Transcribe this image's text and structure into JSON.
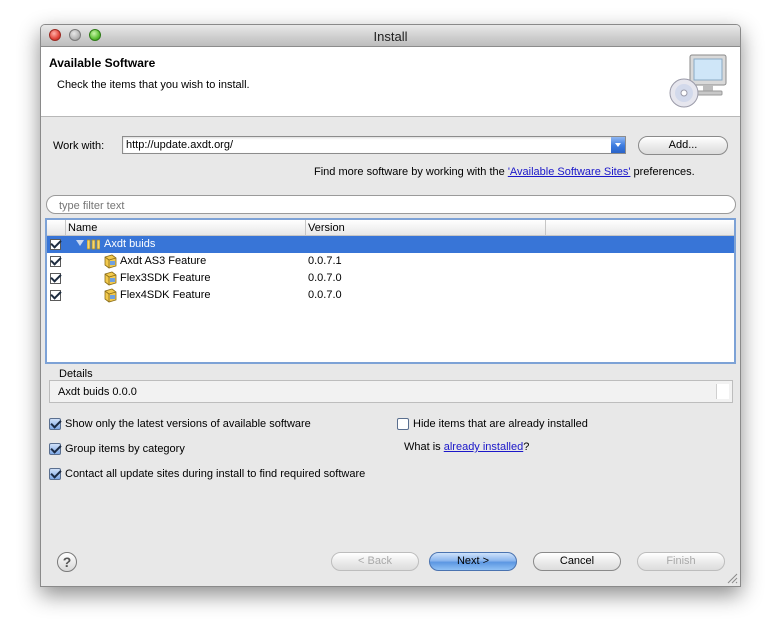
{
  "window": {
    "title": "Install"
  },
  "header": {
    "title": "Available Software",
    "description": "Check the items that you wish to install."
  },
  "work_with": {
    "label": "Work with:",
    "value": "http://update.axdt.org/",
    "add_button": "Add...",
    "more_prefix": "Find more software by working with the ",
    "more_link": "'Available Software Sites'",
    "more_suffix": " preferences."
  },
  "filter": {
    "placeholder": "type filter text"
  },
  "table": {
    "columns": [
      "Name",
      "Version"
    ],
    "rows": [
      {
        "name": "Axdt buids",
        "version": "",
        "checked": true,
        "selected": true,
        "type": "category"
      },
      {
        "name": "Axdt AS3 Feature",
        "version": "0.0.7.1",
        "checked": true,
        "selected": false,
        "type": "feature"
      },
      {
        "name": "Flex3SDK Feature",
        "version": "0.0.7.0",
        "checked": true,
        "selected": false,
        "type": "feature"
      },
      {
        "name": "Flex4SDK Feature",
        "version": "0.0.7.0",
        "checked": true,
        "selected": false,
        "type": "feature"
      }
    ]
  },
  "details": {
    "label": "Details",
    "text": "Axdt buids 0.0.0"
  },
  "options": {
    "show_latest": {
      "label": "Show only the latest versions of available software",
      "checked": true
    },
    "group_by_category": {
      "label": "Group items by category",
      "checked": true
    },
    "contact_sites": {
      "label": "Contact all update sites during install to find required software",
      "checked": true
    },
    "hide_installed": {
      "label": "Hide items that are already installed",
      "checked": false
    },
    "what_is_prefix": "What is ",
    "what_is_link": "already installed",
    "what_is_suffix": "?"
  },
  "buttons": {
    "help": "?",
    "back": "< Back",
    "next": "Next >",
    "cancel": "Cancel",
    "finish": "Finish"
  },
  "colors": {
    "selection": "#3875d7",
    "link": "#1b17c9",
    "dialog_bg": "#e8e8e8"
  }
}
